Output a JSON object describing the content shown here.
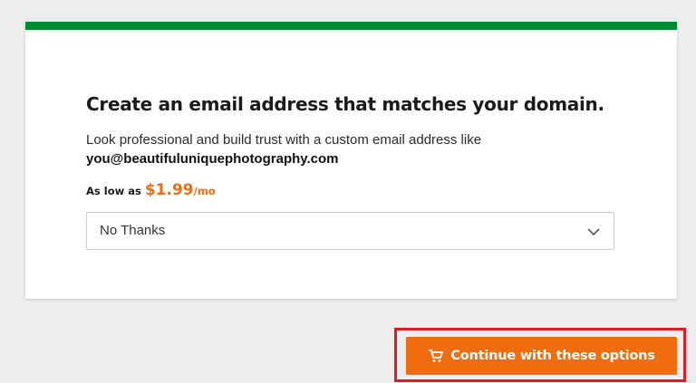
{
  "offer": {
    "headline": "Create an email address that matches your domain.",
    "description": "Look professional and build trust with a custom email address like",
    "example_email": "you@beautifuluniquephotography.com",
    "price_prefix": "As low as",
    "price_amount": "$1.99",
    "price_period": "/mo",
    "select_value": "No Thanks"
  },
  "actions": {
    "continue_label": "Continue with these options"
  },
  "colors": {
    "accent_green": "#008a32",
    "brand_orange": "#ef6c0f",
    "highlight_red": "#e01b24"
  },
  "icons": {
    "select_chevron": "chevron-down-icon",
    "continue_button": "cart-icon"
  }
}
